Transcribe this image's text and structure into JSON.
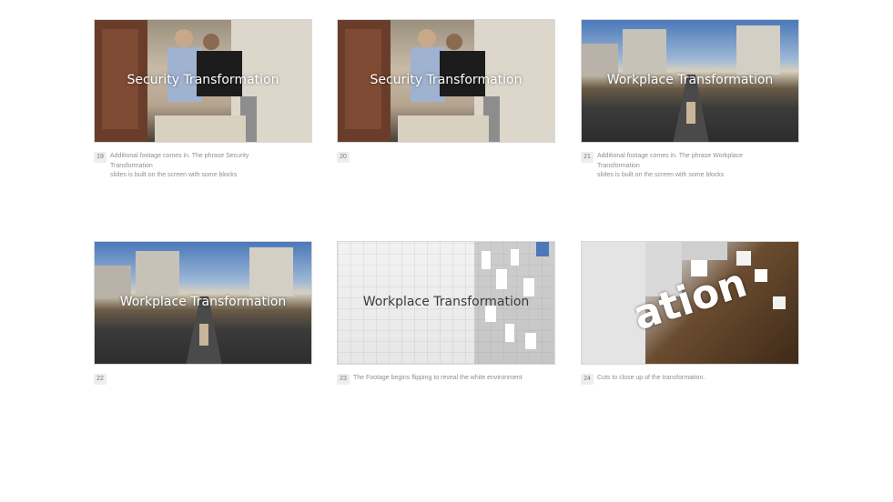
{
  "frames": [
    {
      "number": "19",
      "title": "Security Transformation",
      "description": "Additional footage comes in. The phrase Security\nTransformation\nslides is built on the screen with some blocks"
    },
    {
      "number": "20",
      "title": "Security Transformation",
      "description": ""
    },
    {
      "number": "21",
      "title": "Workplace Transformation",
      "description": "Additional footage comes in. The phrase Workplace\nTransformation\nslides is built on the screen with some blocks"
    },
    {
      "number": "22",
      "title": "Workplace Transformation",
      "description": ""
    },
    {
      "number": "23",
      "title": "Workplace Transformation",
      "description": "The Footage begins flipping to reveal the white environment"
    },
    {
      "number": "24",
      "title": "ation",
      "description": "Cuts to close up of the transformation."
    }
  ]
}
